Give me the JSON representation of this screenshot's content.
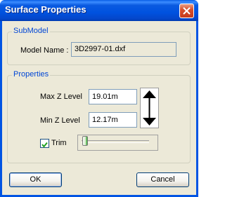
{
  "window": {
    "title": "Surface Properties",
    "close_icon": "close-x-icon"
  },
  "submodel": {
    "legend": "SubModel",
    "model_name_label": "Model Name :",
    "model_name_value": "3D2997-01.dxf"
  },
  "properties": {
    "legend": "Properties",
    "max_z_label": "Max Z Level",
    "max_z_value": "19.01m",
    "min_z_label": "Min Z Level",
    "min_z_value": "12.17m",
    "range_icon": "vertical-double-arrow-icon",
    "trim_label": "Trim",
    "trim_checked": true,
    "trim_slider_value": 0
  },
  "buttons": {
    "ok_label": "OK",
    "cancel_label": "Cancel"
  },
  "colors": {
    "titlebar": "#0054e3",
    "dialog_bg": "#ece9d8",
    "legend_text": "#0046d5"
  }
}
